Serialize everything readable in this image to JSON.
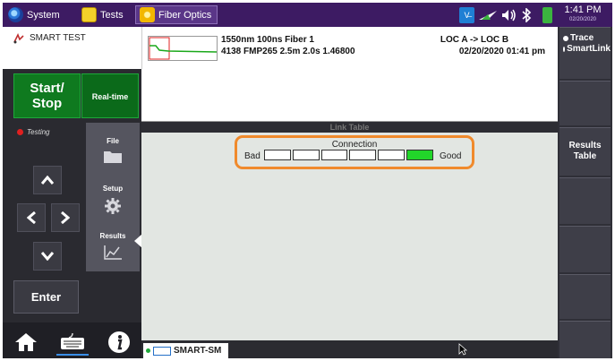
{
  "topbar": {
    "tabs": [
      {
        "label": "System",
        "icon": "system-gear-icon"
      },
      {
        "label": "Tests",
        "icon": "bert-tests-icon"
      },
      {
        "label": "Fiber Optics",
        "icon": "fiber-optics-icon"
      }
    ],
    "vnc_label": "V̶",
    "clock_time": "1:41 PM",
    "clock_date": "02/20/2020"
  },
  "app": {
    "title": "SMART TEST",
    "icon": "smart-test-icon"
  },
  "trace_header": {
    "line1": "1550nm 100ns Fiber 1",
    "line2": "4138 FMP265 2.5m 2.0s 1.46800",
    "location": "LOC A -> LOC B",
    "datetime": "02/20/2020  01:41 pm"
  },
  "right_softkeys": {
    "view_options": [
      {
        "label": "Trace",
        "selected": true
      },
      {
        "label": "SmartLink",
        "selected": false
      }
    ],
    "results_table_line1": "Results",
    "results_table_line2": "Table"
  },
  "left_panel": {
    "start_stop_line1": "Start/",
    "start_stop_line2": "Stop",
    "realtime_label": "Real-time",
    "testing_label": "Testing",
    "menu": {
      "file": "File",
      "setup": "Setup",
      "results": "Results"
    },
    "enter_label": "Enter"
  },
  "main": {
    "link_table_title": "Link Table",
    "connection": {
      "title": "Connection",
      "bad_label": "Bad",
      "good_label": "Good",
      "segments": 6,
      "level": 6
    },
    "bottom_tab_label": "SMART-SM"
  },
  "colors": {
    "topbar": "#3d1b63",
    "start_green": "#0f7a1f",
    "highlight_orange": "#f08a2c",
    "good_green": "#22d62a"
  }
}
